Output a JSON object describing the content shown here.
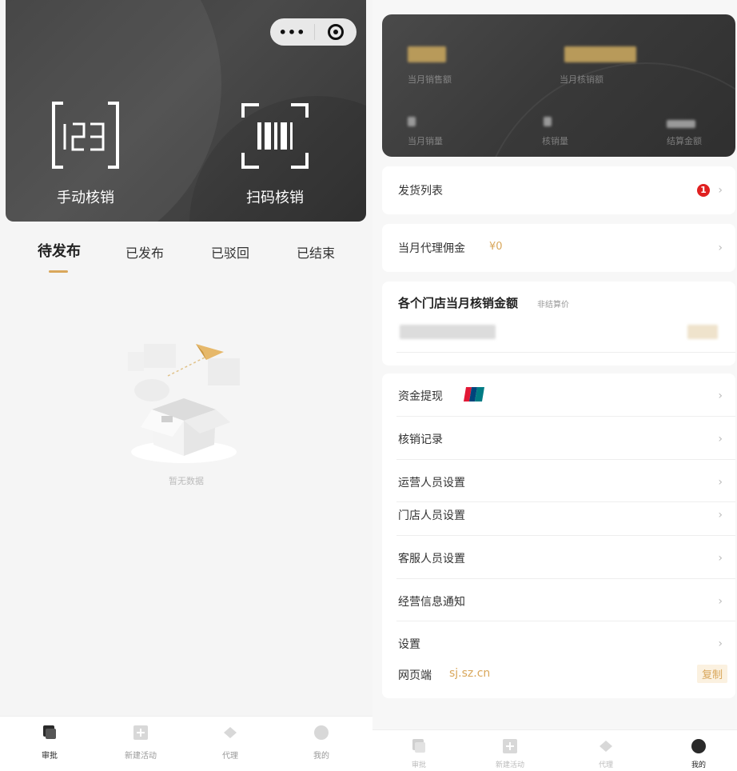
{
  "left": {
    "hero": {
      "more_icon": "more-dots-icon",
      "close_icon": "target-icon",
      "manual_label": "手动核销",
      "scan_label": "扫码核销"
    },
    "tabs": [
      "待发布",
      "已发布",
      "已驳回",
      "已结束"
    ],
    "empty_text": "暂无数据",
    "tabbar": [
      "审批",
      "新建活动",
      "代理",
      "我的"
    ]
  },
  "right": {
    "stats": {
      "month_sales_label": "当月销售额",
      "month_verify_label": "当月核销额",
      "month_sales_count_label": "当月销量",
      "verify_count_label": "核销量",
      "settle_amount_label": "结算金额"
    },
    "shipping": {
      "label": "发货列表",
      "badge": "1"
    },
    "commission": {
      "label": "当月代理佣金",
      "value": "¥0"
    },
    "stores": {
      "title": "各个门店当月核销金额",
      "note": "非结算价"
    },
    "menu": [
      "资金提现",
      "核销记录",
      "运营人员设置",
      "门店人员设置",
      "客服人员设置",
      "经营信息通知",
      "设置"
    ],
    "web": {
      "label": "网页端",
      "url": "sj.sz.cn",
      "copy": "复制"
    },
    "tabbar": [
      "审批",
      "新建活动",
      "代理",
      "我的"
    ]
  },
  "colors": {
    "accent": "#d9a75b",
    "badge": "#e02020",
    "hero": "#3f3f3f"
  }
}
